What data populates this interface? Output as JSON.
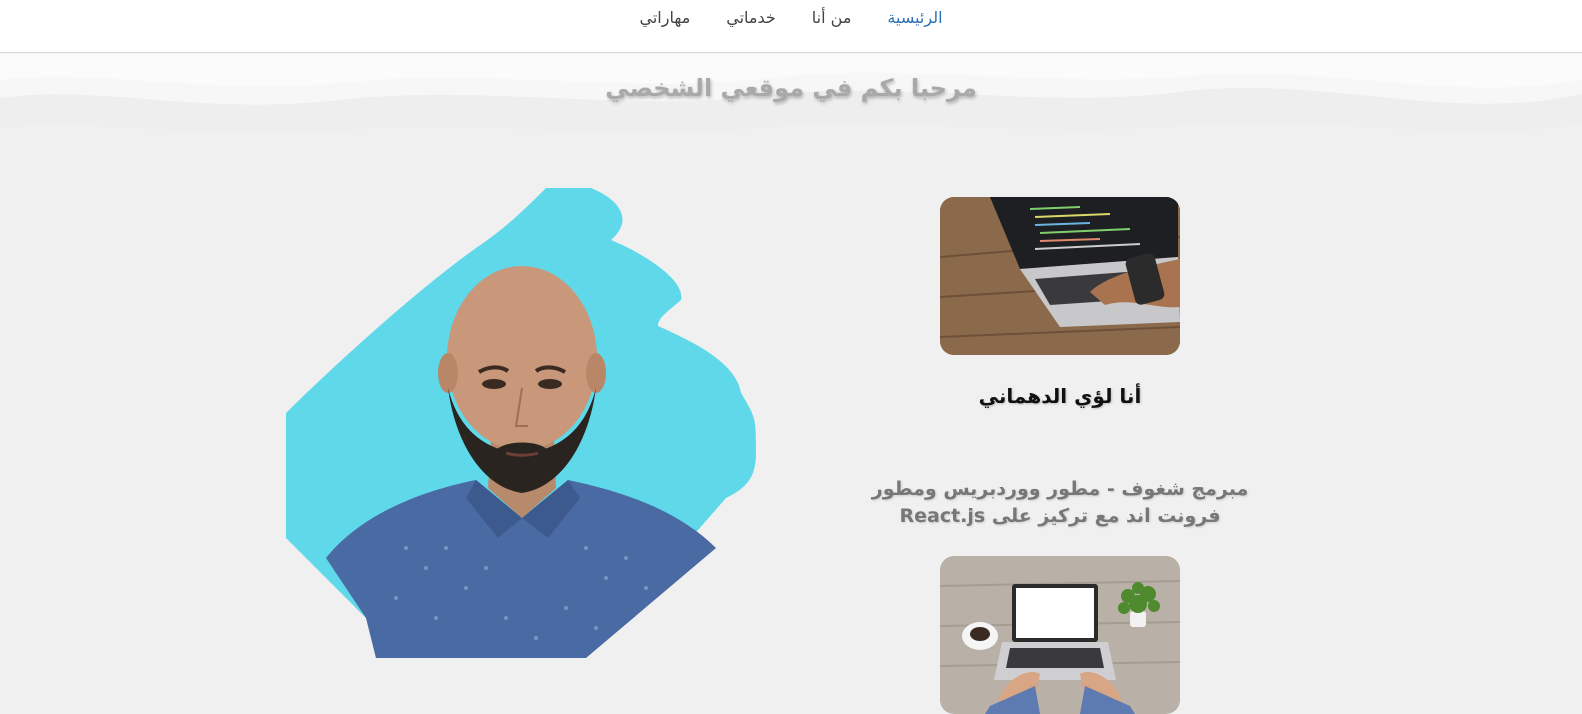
{
  "nav": {
    "items": [
      {
        "label": "الرئيسية",
        "active": true
      },
      {
        "label": "من أنا",
        "active": false
      },
      {
        "label": "خدماتي",
        "active": false
      },
      {
        "label": "مهاراتي",
        "active": false
      }
    ],
    "active_color": "#2a6fb4"
  },
  "hero": {
    "title": "مرحبا بكم في موقعي الشخصي"
  },
  "profile": {
    "name": "أنا لؤي الدهماني",
    "tagline_line1": "مبرمج شغوف - مطور ووردبريس ومطور",
    "tagline_line2": "فرونت اند مع تركيز على React.js"
  },
  "colors": {
    "page_background": "#f0f0f0",
    "portrait_backdrop": "#5fd8ea"
  },
  "images": {
    "portrait": "portrait-photo",
    "card_top": "laptop-code-photo",
    "card_bottom": "laptop-desk-photo"
  }
}
